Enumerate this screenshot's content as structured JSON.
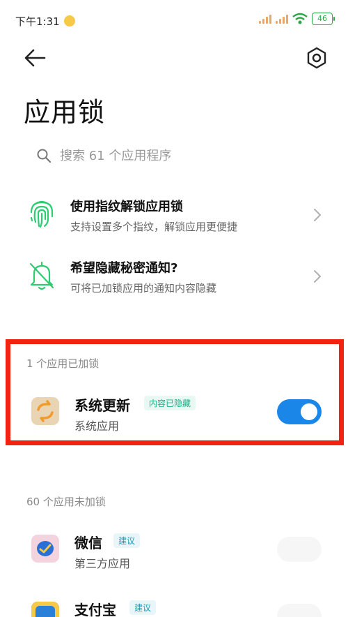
{
  "status": {
    "time": "下午1:31",
    "battery": "46"
  },
  "title": "应用锁",
  "search": {
    "placeholder": "搜索 61 个应用程序"
  },
  "settings": [
    {
      "title": "使用指纹解锁应用锁",
      "subtitle": "支持设置多个指纹，解锁应用更便捷",
      "icon": "fingerprint-icon"
    },
    {
      "title": "希望隐藏秘密通知?",
      "subtitle": "可将已加锁应用的通知内容隐藏",
      "icon": "bell-icon"
    }
  ],
  "locked": {
    "header": "1 个应用已加锁",
    "apps": [
      {
        "name": "系统更新",
        "badge": "内容已隐藏",
        "type": "系统应用",
        "enabled": true
      }
    ]
  },
  "unlocked": {
    "header": "60 个应用未加锁",
    "apps": [
      {
        "name": "微信",
        "badge": "建议",
        "type": "第三方应用",
        "enabled": false
      },
      {
        "name": "支付宝",
        "badge": "建议",
        "type": "",
        "enabled": false
      }
    ]
  },
  "colors": {
    "accent": "#1a86e8",
    "highlight": "#f2230f",
    "icon_green": "#2ecc71"
  }
}
